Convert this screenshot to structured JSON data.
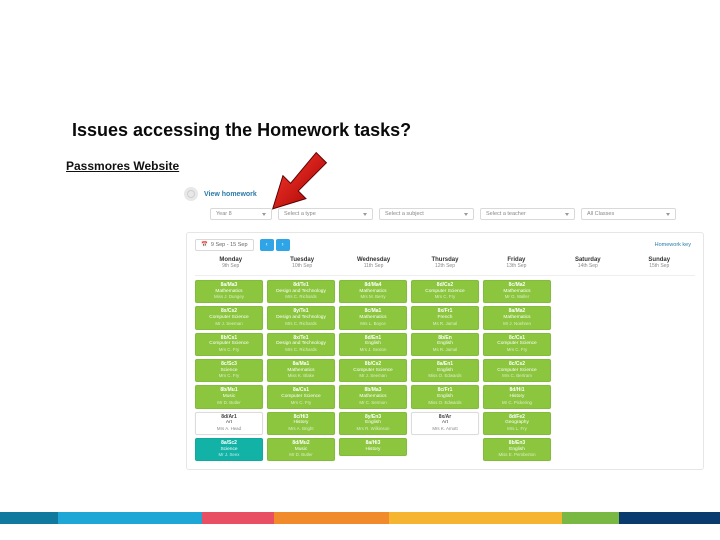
{
  "title": "Issues accessing the Homework tasks?",
  "subtitle": "Passmores Website",
  "header": {
    "viewHomework": "View homework"
  },
  "filters": {
    "year": "Year 8",
    "type": "Select a type",
    "subject": "Select a subject",
    "teacher": "Select a teacher",
    "classes": "All Classes"
  },
  "dateRange": "9 Sep - 15 Sep",
  "hwKey": "Homework key",
  "days": [
    {
      "name": "Monday",
      "date": "9th Sep"
    },
    {
      "name": "Tuesday",
      "date": "10th Sep"
    },
    {
      "name": "Wednesday",
      "date": "11th Sep"
    },
    {
      "name": "Thursday",
      "date": "12th Sep"
    },
    {
      "name": "Friday",
      "date": "13th Sep"
    },
    {
      "name": "Saturday",
      "date": "14th Sep"
    },
    {
      "name": "Sunday",
      "date": "15th Sep"
    }
  ],
  "columns": {
    "mon": [
      {
        "class": "8a/Ma3",
        "sub": "Mathematics",
        "teacher": "Miss J. Dungey",
        "color": "green"
      },
      {
        "class": "8x/Cs2",
        "sub": "Computer Science",
        "teacher": "Mr J. Seeman",
        "color": "green"
      },
      {
        "class": "8b/Cs1",
        "sub": "Computer Science",
        "teacher": "Mrs C. Fry",
        "color": "green"
      },
      {
        "class": "8c/Sc3",
        "sub": "Science",
        "teacher": "Mrs C. Fry",
        "color": "green"
      },
      {
        "class": "8b/Mu1",
        "sub": "Music",
        "teacher": "Mr D. Butler",
        "color": "green"
      },
      {
        "class": "8d/Ar1",
        "sub": "Art",
        "teacher": "Mrs A. Head",
        "color": "white"
      },
      {
        "class": "8a/Sc2",
        "sub": "Science",
        "teacher": "Mr J. Seex",
        "color": "teal"
      }
    ],
    "tue": [
      {
        "class": "8d/Te1",
        "sub": "Design and Technology",
        "teacher": "Mrs C. Richards",
        "color": "green"
      },
      {
        "class": "8y/Te1",
        "sub": "Design and Technology",
        "teacher": "Mrs C. Richards",
        "color": "green"
      },
      {
        "class": "8x/Te1",
        "sub": "Design and Technology",
        "teacher": "Mrs C. Richards",
        "color": "green"
      },
      {
        "class": "8a/Ma1",
        "sub": "Mathematics",
        "teacher": "Miss K. Blake",
        "color": "green"
      },
      {
        "class": "8a/Cs1",
        "sub": "Computer Science",
        "teacher": "Mrs C. Fry",
        "color": "green"
      },
      {
        "class": "8c/Hi3",
        "sub": "History",
        "teacher": "Mrs A. Bright",
        "color": "green"
      },
      {
        "class": "8d/Mu2",
        "sub": "Music",
        "teacher": "Mr D. Butler",
        "color": "green"
      }
    ],
    "wed": [
      {
        "class": "8d/Ma4",
        "sub": "Mathematics",
        "teacher": "Mrs M. Berry",
        "color": "green"
      },
      {
        "class": "8c/Ma1",
        "sub": "Mathematics",
        "teacher": "Mrs L. Boyce",
        "color": "green"
      },
      {
        "class": "8d/En1",
        "sub": "English",
        "teacher": "Mrs J. Sexton",
        "color": "green"
      },
      {
        "class": "8b/Cs2",
        "sub": "Computer Science",
        "teacher": "Mr J. Seeman",
        "color": "green"
      },
      {
        "class": "8b/Ma3",
        "sub": "Mathematics",
        "teacher": "Mr C. Sermon",
        "color": "green"
      },
      {
        "class": "8y/En3",
        "sub": "English",
        "teacher": "Mrs R. Wilkinson",
        "color": "green"
      },
      {
        "class": "8a/Hi3",
        "sub": "History",
        "teacher": "",
        "color": "green"
      }
    ],
    "thu": [
      {
        "class": "8d/Cs2",
        "sub": "Computer Science",
        "teacher": "Mrs C. Fry",
        "color": "green"
      },
      {
        "class": "8x/Fr1",
        "sub": "French",
        "teacher": "Ms R. Jamal",
        "color": "green"
      },
      {
        "class": "8b/En",
        "sub": "English",
        "teacher": "Ms R. Jamal",
        "color": "green"
      },
      {
        "class": "8a/En1",
        "sub": "English",
        "teacher": "Miss O. Edwards",
        "color": "green"
      },
      {
        "class": "8c/Fr1",
        "sub": "English",
        "teacher": "Miss O. Edwards",
        "color": "green"
      },
      {
        "class": "8x/Ar",
        "sub": "Art",
        "teacher": "Mrs K. Arnott",
        "color": "white"
      }
    ],
    "fri": [
      {
        "class": "8c/Ma2",
        "sub": "Mathematics",
        "teacher": "Mr G. Waller",
        "color": "green"
      },
      {
        "class": "8a/Ma2",
        "sub": "Mathematics",
        "teacher": "Mr J. Noehren",
        "color": "green"
      },
      {
        "class": "8c/Cs1",
        "sub": "Computer Science",
        "teacher": "Mrs C. Fry",
        "color": "green"
      },
      {
        "class": "8c/Cs2",
        "sub": "Computer Science",
        "teacher": "Mrs C. Bertram",
        "color": "green"
      },
      {
        "class": "8d/Hi1",
        "sub": "History",
        "teacher": "Mr C. Pickering",
        "color": "green"
      },
      {
        "class": "8d/Fe2",
        "sub": "Geography",
        "teacher": "Mrs L. Fry",
        "color": "green"
      },
      {
        "class": "8b/En3",
        "sub": "English",
        "teacher": "Miss E. Pemberton",
        "color": "green"
      }
    ],
    "sat": [],
    "sun": []
  }
}
